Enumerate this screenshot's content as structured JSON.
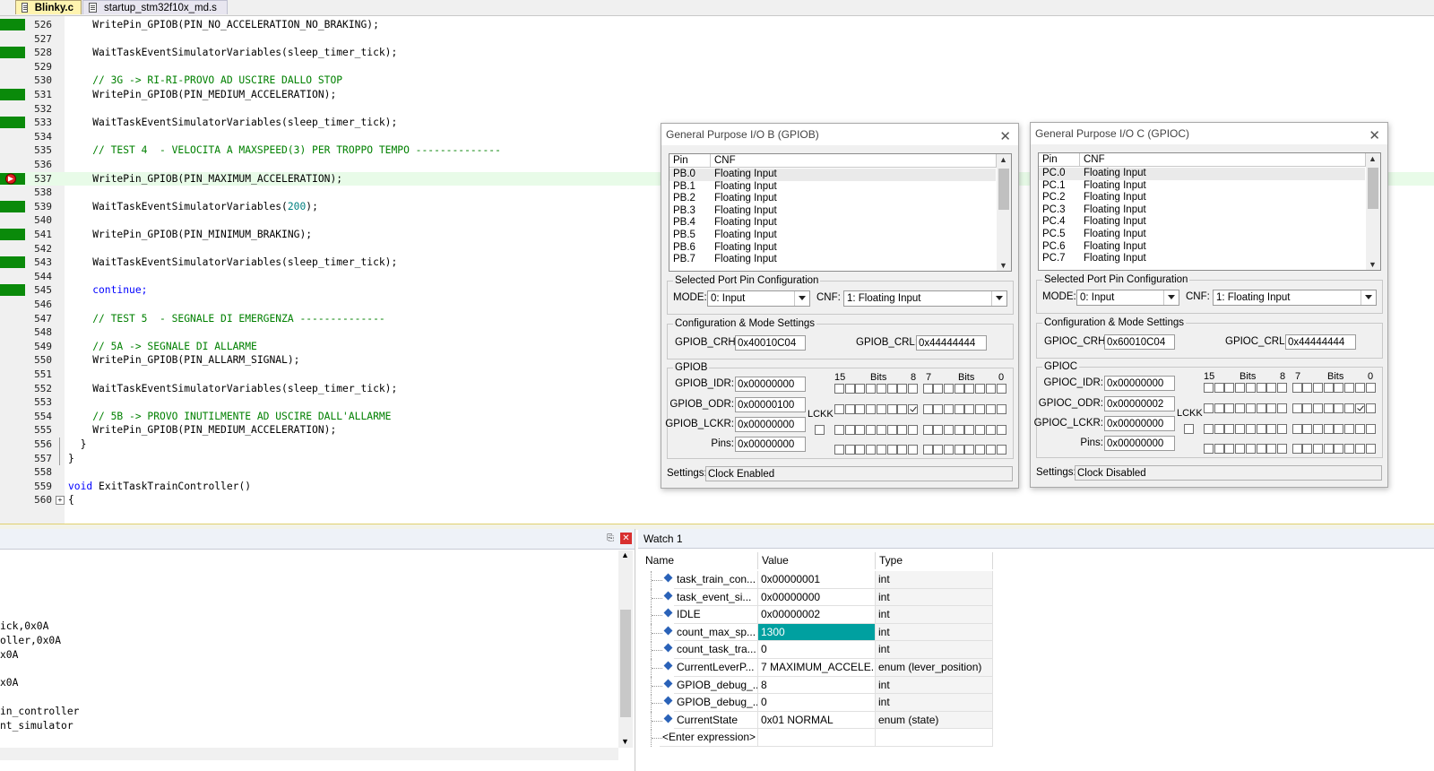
{
  "tabs": [
    {
      "label": "Blinky.c",
      "active": true
    },
    {
      "label": "startup_stm32f10x_md.s",
      "active": false
    }
  ],
  "editor": {
    "lines": [
      {
        "num": "526",
        "code": "    WritePin_GPIOB(PIN_NO_ACCELERATION_NO_BRAKING);",
        "cov": true,
        "kind": "code"
      },
      {
        "num": "527",
        "code": "",
        "cov": false,
        "kind": "code"
      },
      {
        "num": "528",
        "code": "    WaitTaskEventSimulatorVariables(sleep_timer_tick);",
        "cov": true,
        "kind": "code"
      },
      {
        "num": "529",
        "code": "",
        "cov": false,
        "kind": "code"
      },
      {
        "num": "530",
        "code": "    // 3G -> RI-RI-PROVO AD USCIRE DALLO STOP",
        "cov": false,
        "kind": "comment"
      },
      {
        "num": "531",
        "code": "    WritePin_GPIOB(PIN_MEDIUM_ACCELERATION);",
        "cov": true,
        "kind": "code"
      },
      {
        "num": "532",
        "code": "",
        "cov": false,
        "kind": "code"
      },
      {
        "num": "533",
        "code": "    WaitTaskEventSimulatorVariables(sleep_timer_tick);",
        "cov": true,
        "kind": "code"
      },
      {
        "num": "534",
        "code": "",
        "cov": false,
        "kind": "code"
      },
      {
        "num": "535",
        "code": "    // TEST 4  - VELOCITA A MAXSPEED(3) PER TROPPO TEMPO --------------",
        "cov": false,
        "kind": "comment"
      },
      {
        "num": "536",
        "code": "",
        "cov": false,
        "kind": "code"
      },
      {
        "num": "537",
        "code": "    WritePin_GPIOB(PIN_MAXIMUM_ACCELERATION);",
        "cov": true,
        "kind": "current"
      },
      {
        "num": "538",
        "code": "",
        "cov": false,
        "kind": "code"
      },
      {
        "num": "539",
        "code": "    WaitTaskEventSimulatorVariables(",
        "num_arg": "200",
        "code_tail": ");",
        "cov": true,
        "kind": "numarg"
      },
      {
        "num": "540",
        "code": "",
        "cov": false,
        "kind": "code"
      },
      {
        "num": "541",
        "code": "    WritePin_GPIOB(PIN_MINIMUM_BRAKING);",
        "cov": true,
        "kind": "code"
      },
      {
        "num": "542",
        "code": "",
        "cov": false,
        "kind": "code"
      },
      {
        "num": "543",
        "code": "    WaitTaskEventSimulatorVariables(sleep_timer_tick);",
        "cov": true,
        "kind": "code"
      },
      {
        "num": "544",
        "code": "",
        "cov": false,
        "kind": "code"
      },
      {
        "num": "545",
        "code": "    continue;",
        "cov": true,
        "kind": "keyword"
      },
      {
        "num": "546",
        "code": "",
        "cov": false,
        "kind": "code"
      },
      {
        "num": "547",
        "code": "    // TEST 5  - SEGNALE DI EMERGENZA --------------",
        "cov": false,
        "kind": "comment"
      },
      {
        "num": "548",
        "code": "",
        "cov": false,
        "kind": "code"
      },
      {
        "num": "549",
        "code": "    // 5A -> SEGNALE DI ALLARME",
        "cov": false,
        "kind": "comment"
      },
      {
        "num": "550",
        "code": "    WritePin_GPIOB(PIN_ALLARM_SIGNAL);",
        "cov": false,
        "kind": "code"
      },
      {
        "num": "551",
        "code": "",
        "cov": false,
        "kind": "code"
      },
      {
        "num": "552",
        "code": "    WaitTaskEventSimulatorVariables(sleep_timer_tick);",
        "cov": false,
        "kind": "code"
      },
      {
        "num": "553",
        "code": "",
        "cov": false,
        "kind": "code"
      },
      {
        "num": "554",
        "code": "    // 5B -> PROVO INUTILMENTE AD USCIRE DALL'ALLARME",
        "cov": false,
        "kind": "comment"
      },
      {
        "num": "555",
        "code": "    WritePin_GPIOB(PIN_MEDIUM_ACCELERATION);",
        "cov": false,
        "kind": "code"
      },
      {
        "num": "556",
        "code": "  }",
        "cov": false,
        "kind": "code"
      },
      {
        "num": "557",
        "code": "}",
        "cov": false,
        "kind": "code"
      },
      {
        "num": "558",
        "code": "",
        "cov": false,
        "kind": "code"
      },
      {
        "num": "559",
        "code": "void",
        "code_rest": " ExitTaskTrainController()",
        "cov": false,
        "kind": "voiddecl"
      },
      {
        "num": "560",
        "code": "{",
        "cov": false,
        "kind": "code"
      }
    ]
  },
  "output": {
    "lines": [
      "ick,0x0A",
      "oller,0x0A",
      "x0A",
      "",
      "x0A",
      "",
      "in_controller",
      "nt_simulator"
    ]
  },
  "watch": {
    "title": "Watch 1",
    "headers": {
      "name": "Name",
      "value": "Value",
      "type": "Type"
    },
    "rows": [
      {
        "name": "task_train_con...",
        "value": "0x00000001",
        "type": "int",
        "highlight": false
      },
      {
        "name": "task_event_si...",
        "value": "0x00000000",
        "type": "int",
        "highlight": false
      },
      {
        "name": "IDLE",
        "value": "0x00000002",
        "type": "int",
        "highlight": false
      },
      {
        "name": "count_max_sp...",
        "value": "1300",
        "type": "int",
        "highlight": true
      },
      {
        "name": "count_task_tra...",
        "value": "0",
        "type": "int",
        "highlight": false
      },
      {
        "name": "CurrentLeverP...",
        "value": "7 MAXIMUM_ACCELE...",
        "type": "enum (lever_position)",
        "highlight": false
      },
      {
        "name": "GPIOB_debug_...",
        "value": "8",
        "type": "int",
        "highlight": false
      },
      {
        "name": "GPIOB_debug_...",
        "value": "0",
        "type": "int",
        "highlight": false
      },
      {
        "name": "CurrentState",
        "value": "0x01 NORMAL",
        "type": "enum (state)",
        "highlight": false
      }
    ],
    "enter_expression": "<Enter expression>",
    "highlight_color": "#00a0a0"
  },
  "gpiob": {
    "title": "General Purpose I/O B (GPIOB)",
    "list_headers": {
      "pin": "Pin",
      "cnf": "CNF"
    },
    "pins": [
      {
        "pin": "PB.0",
        "cnf": "Floating Input"
      },
      {
        "pin": "PB.1",
        "cnf": "Floating Input"
      },
      {
        "pin": "PB.2",
        "cnf": "Floating Input"
      },
      {
        "pin": "PB.3",
        "cnf": "Floating Input"
      },
      {
        "pin": "PB.4",
        "cnf": "Floating Input"
      },
      {
        "pin": "PB.5",
        "cnf": "Floating Input"
      },
      {
        "pin": "PB.6",
        "cnf": "Floating Input"
      },
      {
        "pin": "PB.7",
        "cnf": "Floating Input"
      }
    ],
    "selected_group": "Selected Port Pin Configuration",
    "mode_label": "MODE:",
    "mode_value": "0: Input",
    "cnf_label": "CNF:",
    "cnf_value": "1: Floating Input",
    "config_group": "Configuration & Mode Settings",
    "crh_label": "GPIOB_CRH:",
    "crh_value": "0x40010C04",
    "crl_label": "GPIOB_CRL:",
    "crl_value": "0x44444444",
    "reg_group": "GPIOB",
    "idr_label": "GPIOB_IDR:",
    "idr_value": "0x00000000",
    "odr_label": "GPIOB_ODR:",
    "odr_value": "0x00000100",
    "lckr_label": "GPIOB_LCKR:",
    "lckr_value": "0x00000000",
    "pins_label": "Pins:",
    "pins_value": "0x00000000",
    "lckk": "LCKK",
    "bit15": "15",
    "bits": "Bits",
    "bit8": "8",
    "bit7": "7",
    "bit0": "0",
    "settings_label": "Settings:",
    "settings_value": "Clock Enabled",
    "odr_checked_bit": 8
  },
  "gpioc": {
    "title": "General Purpose I/O C (GPIOC)",
    "list_headers": {
      "pin": "Pin",
      "cnf": "CNF"
    },
    "pins": [
      {
        "pin": "PC.0",
        "cnf": "Floating Input"
      },
      {
        "pin": "PC.1",
        "cnf": "Floating Input"
      },
      {
        "pin": "PC.2",
        "cnf": "Floating Input"
      },
      {
        "pin": "PC.3",
        "cnf": "Floating Input"
      },
      {
        "pin": "PC.4",
        "cnf": "Floating Input"
      },
      {
        "pin": "PC.5",
        "cnf": "Floating Input"
      },
      {
        "pin": "PC.6",
        "cnf": "Floating Input"
      },
      {
        "pin": "PC.7",
        "cnf": "Floating Input"
      }
    ],
    "selected_group": "Selected Port Pin Configuration",
    "mode_label": "MODE:",
    "mode_value": "0: Input",
    "cnf_label": "CNF:",
    "cnf_value": "1: Floating Input",
    "config_group": "Configuration & Mode Settings",
    "crh_label": "GPIOC_CRH:",
    "crh_value": "0x60010C04",
    "crl_label": "GPIOC_CRL:",
    "crl_value": "0x44444444",
    "reg_group": "GPIOC",
    "idr_label": "GPIOC_IDR:",
    "idr_value": "0x00000000",
    "odr_label": "GPIOC_ODR:",
    "odr_value": "0x00000002",
    "lckr_label": "GPIOC_LCKR:",
    "lckr_value": "0x00000000",
    "pins_label": "Pins:",
    "pins_value": "0x00000000",
    "lckk": "LCKK",
    "bit15": "15",
    "bits": "Bits",
    "bit8": "8",
    "bit7": "7",
    "bit0": "0",
    "settings_label": "Settings:",
    "settings_value": "Clock Disabled",
    "odr_checked_bit": 1
  },
  "colors": {
    "coverage": "#0a8a0a",
    "comment": "#008000",
    "keyword": "#0000ff",
    "number": "#008080",
    "active_tab": "#fff4b0"
  }
}
